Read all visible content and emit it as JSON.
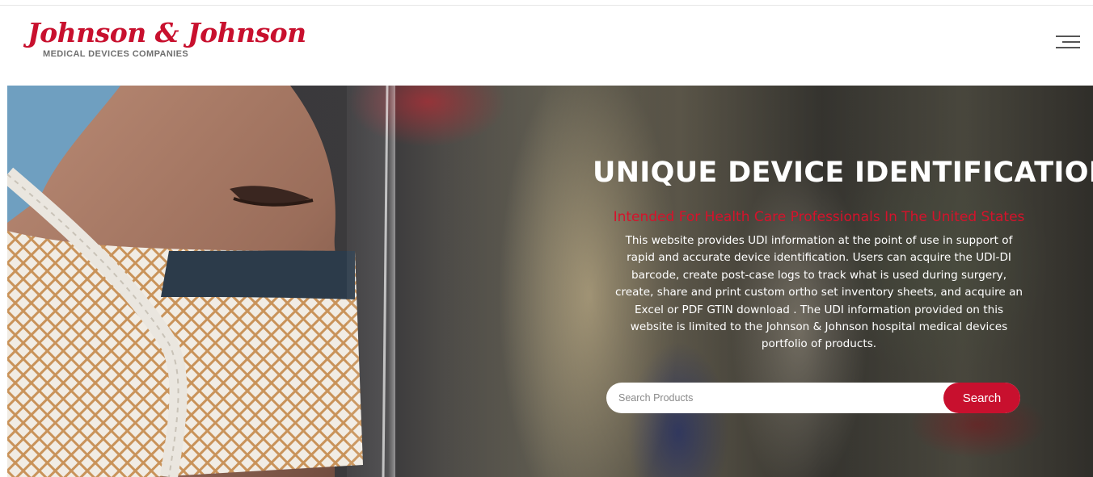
{
  "header": {
    "logo_text": "Johnson & Johnson",
    "logo_subtitle": "MEDICAL DEVICES COMPANIES",
    "menu_icon": "hamburger-menu-icon"
  },
  "hero": {
    "title": "UNIQUE DEVICE IDENTIFICATION",
    "subtitle": "Intended For Health Care Professionals In The United States",
    "description": "This website provides UDI information at the point of use in support of rapid and accurate device identification. Users can acquire the UDI-DI barcode, create post-case logs to track what is used during surgery, create, share and print custom ortho set inventory sheets, and acquire an Excel or PDF GTIN download . The UDI information provided on this website is limited to the Johnson & Johnson hospital medical devices portfolio of products.",
    "image_subject": "surgeon-in-mask-and-face-shield"
  },
  "search": {
    "placeholder": "Search Products",
    "value": "",
    "button_label": "Search"
  },
  "colors": {
    "brand_red": "#c8102e",
    "subtitle_red": "#d6122b",
    "text_white": "#ffffff"
  }
}
